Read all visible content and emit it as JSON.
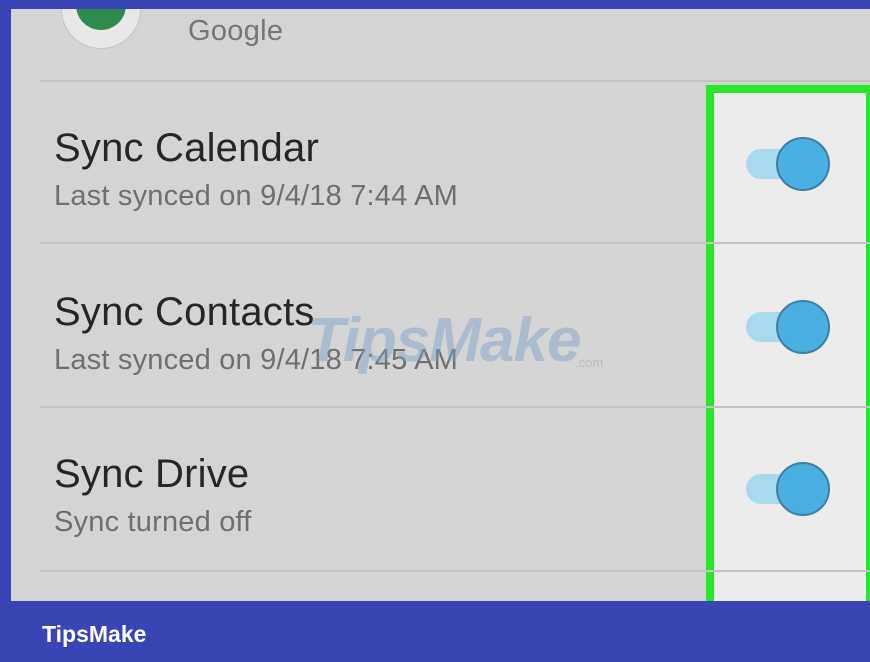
{
  "account": {
    "name": "Google"
  },
  "sync_items": [
    {
      "title": "Sync Calendar",
      "subtitle": "Last synced on 9/4/18  7:44 AM",
      "enabled": true
    },
    {
      "title": "Sync Contacts",
      "subtitle": "Last synced on 9/4/18  7:45 AM",
      "enabled": true
    },
    {
      "title": "Sync Drive",
      "subtitle": "Sync turned off",
      "enabled": true
    }
  ],
  "watermark": {
    "text": "TipsMake",
    "suffix": ".com"
  },
  "footer": {
    "brand": "TipsMake"
  },
  "colors": {
    "highlight": "#28e628",
    "toggle_on_knob": "#4aafe1",
    "toggle_on_track": "#a9d9ee",
    "frame": "#3a45b5"
  }
}
